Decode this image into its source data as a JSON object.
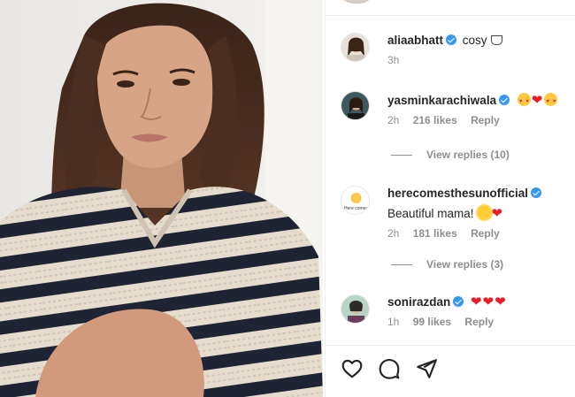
{
  "post": {
    "image_icon": "portrait-photo"
  },
  "comments": [
    {
      "username": "aliaabhatt",
      "verified": true,
      "text": "cosy",
      "emoji": "coffee-cup",
      "time": "3h",
      "likes": "",
      "reply": ""
    },
    {
      "username": "yasminkarachiwala",
      "verified": true,
      "text": "",
      "emoji": "heart-eyes-heart-heart-eyes",
      "time": "2h",
      "likes": "216 likes",
      "reply": "Reply",
      "view_replies": "View replies (10)"
    },
    {
      "username": "herecomesthesunofficial",
      "verified": true,
      "text": "Beautiful mama!",
      "emoji": "sun-heart",
      "time": "2h",
      "likes": "181 likes",
      "reply": "Reply",
      "view_replies": "View replies (3)",
      "avatar_text": "Here comes the sun"
    },
    {
      "username": "sonirazdan",
      "verified": true,
      "text": "",
      "emoji": "three-hearts",
      "time": "1h",
      "likes": "99 likes",
      "reply": "Reply"
    }
  ],
  "actions": [
    "heart-icon",
    "comment-icon",
    "share-icon"
  ],
  "colors": {
    "verified": "#3897f0",
    "heart": "#ed1c24",
    "muted_text": "#8e8e8e"
  }
}
